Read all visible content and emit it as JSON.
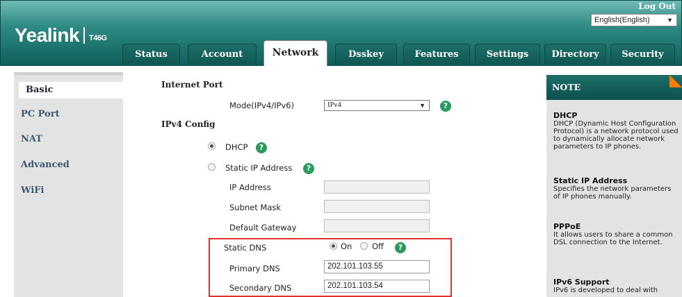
{
  "header": {
    "brand": "Yealink",
    "model": "T46G",
    "logout_label": "Log Out",
    "language_value": "English(English)"
  },
  "tabs": [
    {
      "label": "Status"
    },
    {
      "label": "Account"
    },
    {
      "label": "Network",
      "active": true
    },
    {
      "label": "Dsskey"
    },
    {
      "label": "Features"
    },
    {
      "label": "Settings"
    },
    {
      "label": "Directory"
    },
    {
      "label": "Security"
    }
  ],
  "sidebar": {
    "items": [
      {
        "label": "Basic",
        "active": true
      },
      {
        "label": "PC Port"
      },
      {
        "label": "NAT"
      },
      {
        "label": "Advanced"
      },
      {
        "label": "WiFi"
      }
    ]
  },
  "main": {
    "internet_port_label": "Internet Port",
    "mode_label": "Mode(IPv4/IPv6)",
    "mode_value": "IPv4",
    "ipv4_config_label": "IPv4 Config",
    "dhcp_label": "DHCP",
    "static_ip_label": "Static IP Address",
    "ip_address_label": "IP Address",
    "subnet_mask_label": "Subnet Mask",
    "default_gateway_label": "Default Gateway",
    "static_dns_label": "Static DNS",
    "on_label": "On",
    "off_label": "Off",
    "primary_dns_label": "Primary DNS",
    "primary_dns_value": "202.101.103.55",
    "secondary_dns_label": "Secondary DNS",
    "secondary_dns_value": "202.101.103.54",
    "help_glyph": "?"
  },
  "note": {
    "heading": "NOTE",
    "sections": [
      {
        "title": "DHCP",
        "text": "DHCP (Dynamic Host Configuration Protocol) is a network protocol used to dynamically allocate network parameters to IP phones."
      },
      {
        "title": "Static IP Address",
        "text": "Specifies the network parameters of IP phones manually."
      },
      {
        "title": "PPPoE",
        "text": "It allows users to share a common DSL connection to the Internet."
      },
      {
        "title": "IPv6 Support",
        "text": "IPv6 is developed to deal with"
      }
    ]
  },
  "colors": {
    "header_teal": "#1d6e69",
    "help_green": "#2b9a5d",
    "highlight_red": "#e03030",
    "note_corner_orange": "#ff7a00"
  }
}
